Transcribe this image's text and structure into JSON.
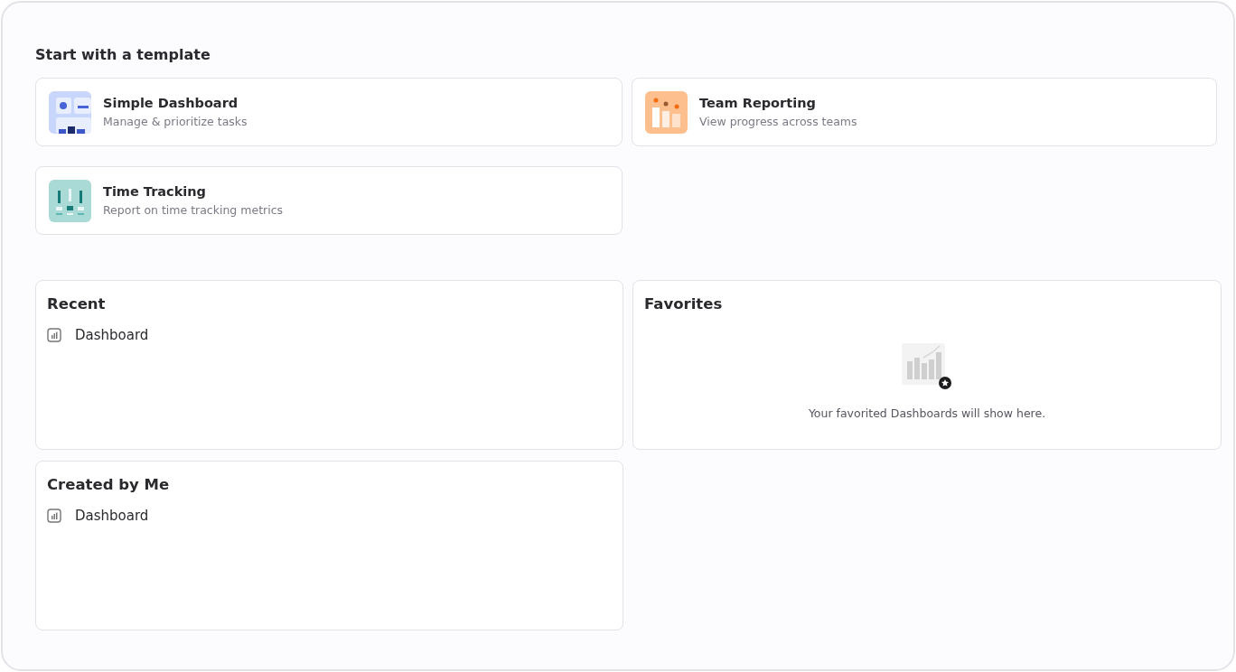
{
  "heading": "Start with a template",
  "templates": [
    {
      "kind": "dashboard",
      "title": "Simple Dashboard",
      "subtitle": "Manage & prioritize tasks"
    },
    {
      "kind": "reporting",
      "title": "Team Reporting",
      "subtitle": "View progress across teams"
    },
    {
      "kind": "tracking",
      "title": "Time Tracking",
      "subtitle": "Report on time tracking metrics"
    }
  ],
  "sections": [
    {
      "title": "Recent",
      "items": [
        {
          "label": "Dashboard"
        }
      ]
    },
    {
      "title": "Favorites",
      "empty_message": "Your favorited Dashboards will show here."
    },
    {
      "title": "Created by Me",
      "items": [
        {
          "label": "Dashboard"
        }
      ]
    }
  ]
}
